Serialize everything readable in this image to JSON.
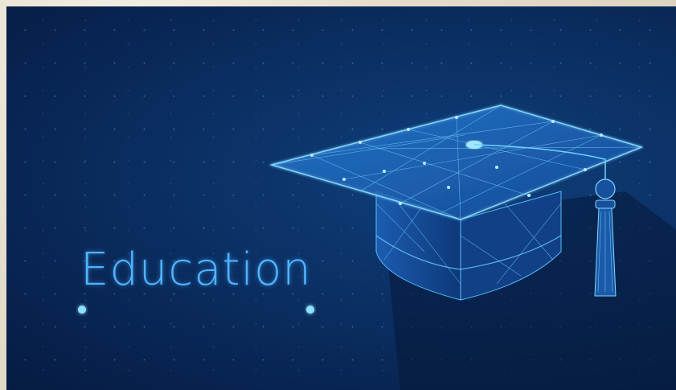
{
  "banner": {
    "title": "Education"
  },
  "colors": {
    "background": "#0b2f63",
    "accent": "#4fb3ff",
    "glow": "#6fd1ff"
  },
  "icons": {
    "cap": "graduation-cap-icon",
    "underline": "glowing-line"
  }
}
